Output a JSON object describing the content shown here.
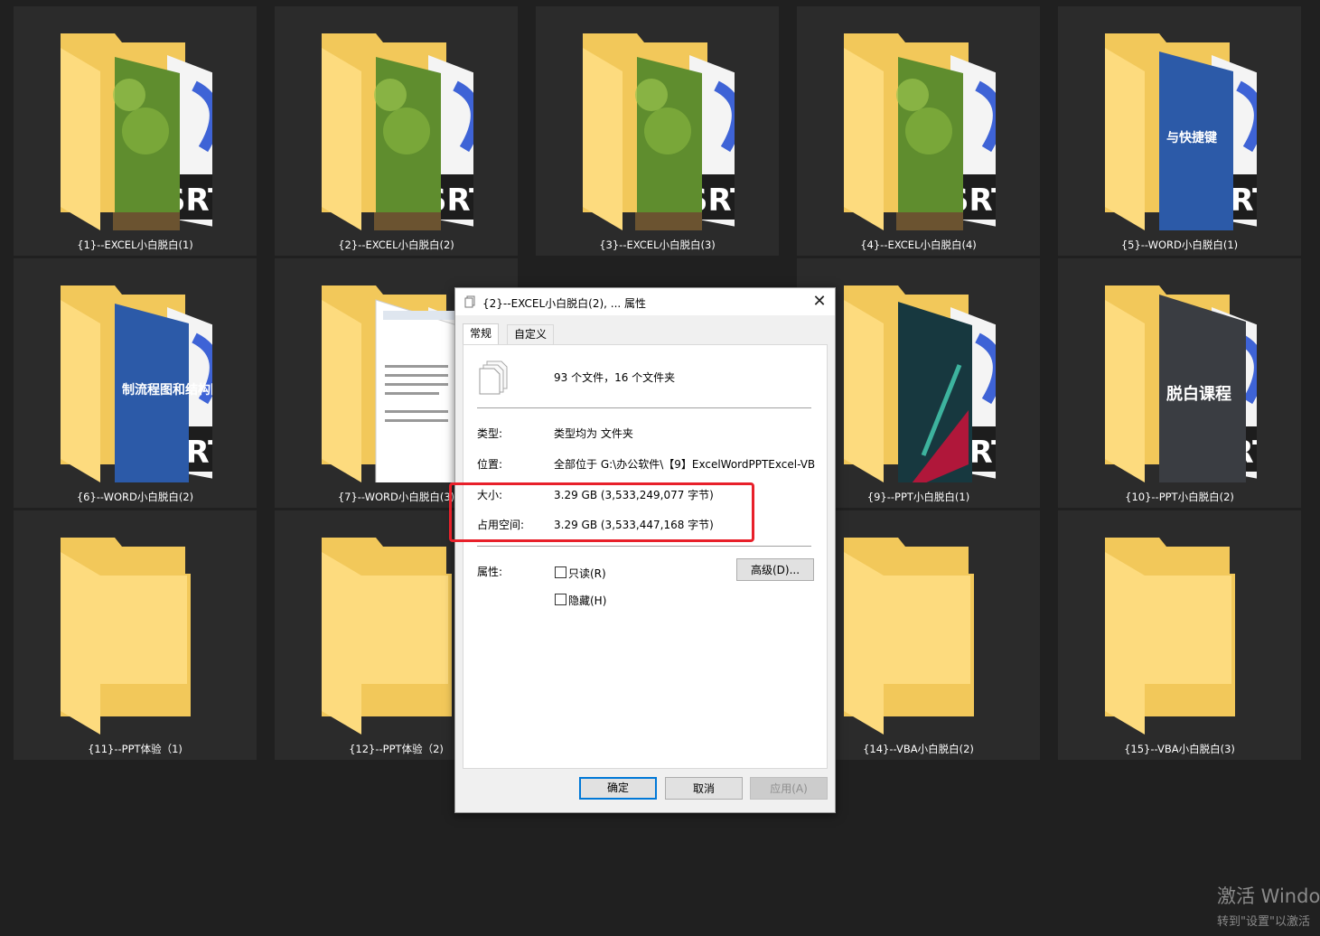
{
  "folders": [
    {
      "label": "{1}--EXCEL小白脱白(1)",
      "cover": "photo"
    },
    {
      "label": "{2}--EXCEL小白脱白(2)",
      "cover": "photo"
    },
    {
      "label": "{3}--EXCEL小白脱白(3)",
      "cover": "photo"
    },
    {
      "label": "{4}--EXCEL小白脱白(4)",
      "cover": "photo"
    },
    {
      "label": "{5}--WORD小白脱白(1)",
      "cover": "blue-book",
      "cover_text": "与快捷键"
    },
    {
      "label": "{6}--WORD小白脱白(2)",
      "cover": "blue-book",
      "cover_text": "制流程图和结构图"
    },
    {
      "label": "{7}--WORD小白脱白(3)",
      "cover": "document"
    },
    {
      "label": "",
      "cover": "hidden"
    },
    {
      "label": "{9}--PPT小白脱白(1)",
      "cover": "dark-red"
    },
    {
      "label": "{10}--PPT小白脱白(2)",
      "cover": "dark-book",
      "cover_text": "脱白课程"
    },
    {
      "label": "{11}--PPT体验（1)",
      "cover": "empty"
    },
    {
      "label": "{12}--PPT体验（2)",
      "cover": "empty"
    },
    {
      "label": "",
      "cover": "hidden"
    },
    {
      "label": "{14}--VBA小白脱白(2)",
      "cover": "empty"
    },
    {
      "label": "{15}--VBA小白脱白(3)",
      "cover": "empty"
    }
  ],
  "srt_text": "SRT",
  "dialog": {
    "title": "{2}--EXCEL小白脱白(2), ... 属性",
    "tabs": [
      "常规",
      "自定义"
    ],
    "summary": "93 个文件，16 个文件夹",
    "type_label": "类型:",
    "type_value": "类型均为 文件夹",
    "location_label": "位置:",
    "location_value": "全部位于 G:\\办公软件\\【9】ExcelWordPPTExcel-VB",
    "size_label": "大小:",
    "size_value": "3.29 GB (3,533,249,077 字节)",
    "disk_label": "占用空间:",
    "disk_value": "3.29 GB (3,533,447,168 字节)",
    "attr_label": "属性:",
    "readonly_label": "只读(R)",
    "hidden_label": "隐藏(H)",
    "advanced_label": "高级(D)...",
    "ok_label": "确定",
    "cancel_label": "取消",
    "apply_label": "应用(A)"
  },
  "watermark": {
    "line1": "激活 Window",
    "line2": "转到\"设置\"以激活"
  },
  "colors": {
    "desktop_bg": "#202020",
    "tile_bg": "#2b2b2b",
    "folder_back": "#f2c85a",
    "folder_front": "#fddb7e",
    "highlight": "#e8202a",
    "accent": "#0078d7"
  }
}
